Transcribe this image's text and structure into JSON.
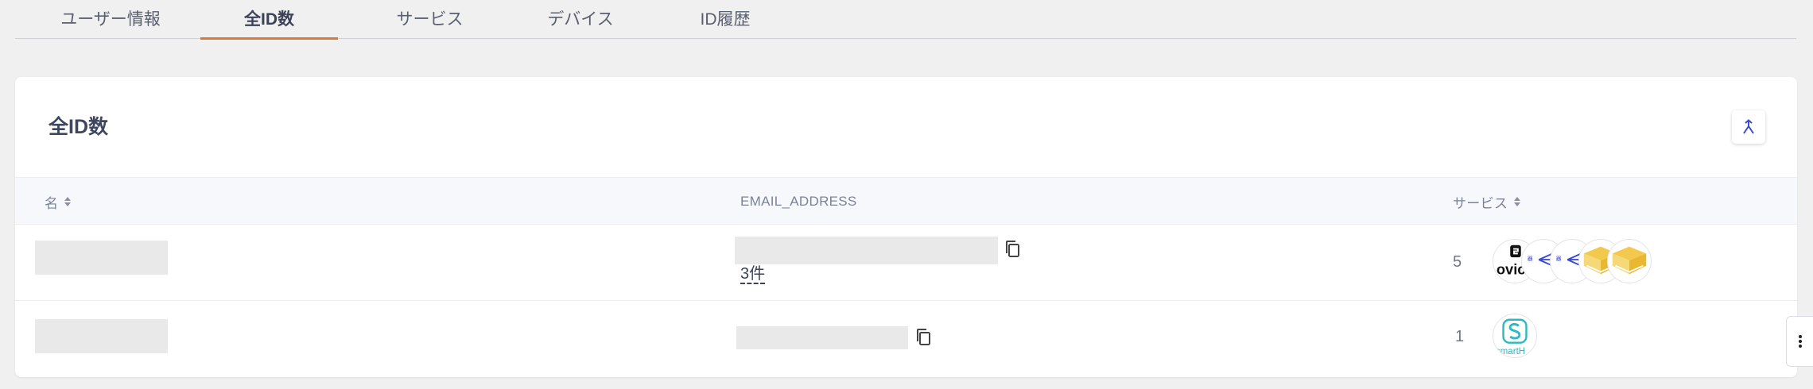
{
  "tabs": [
    {
      "label": "ユーザー情報",
      "active": false
    },
    {
      "label": "全ID数",
      "active": true
    },
    {
      "label": "サービス",
      "active": false
    },
    {
      "label": "デバイス",
      "active": false
    },
    {
      "label": "ID履歴",
      "active": false
    }
  ],
  "card": {
    "title": "全ID数",
    "collapse_icon": "collapse-icon"
  },
  "table": {
    "columns": {
      "name": "名",
      "email": "EMAIL_ADDRESS",
      "services": "サービス"
    },
    "rows": [
      {
        "name": "",
        "email": "",
        "email_count": "3件",
        "service_count": "5",
        "service_logos": [
          "ovic-logo",
          "arrow-logo",
          "arrow-logo",
          "box-logo",
          "box-logo"
        ]
      },
      {
        "name": "",
        "email": "",
        "email_count": "",
        "service_count": "1",
        "service_logos": [
          "smart-logo"
        ]
      }
    ]
  },
  "colors": {
    "accent_tab": "#d57a3b",
    "link": "#3b4bd6",
    "teal": "#2cb9c3",
    "yellow": "#f2c94c"
  }
}
